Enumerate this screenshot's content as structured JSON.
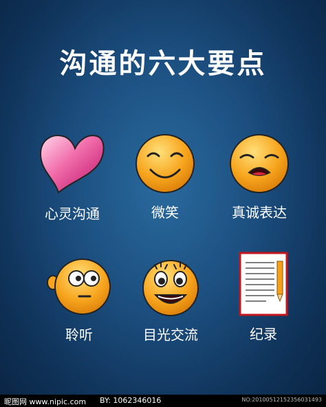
{
  "title": "沟通的六大要点",
  "items": [
    {
      "label": "心灵沟通",
      "icon": "heart-icon"
    },
    {
      "label": "微笑",
      "icon": "smiling-face-icon"
    },
    {
      "label": "真诚表达",
      "icon": "open-mouth-face-icon"
    },
    {
      "label": "聆听",
      "icon": "listening-face-icon"
    },
    {
      "label": "目光交流",
      "icon": "big-eyes-face-icon"
    },
    {
      "label": "纪录",
      "icon": "notepad-pencil-icon"
    }
  ],
  "footer": {
    "site": "昵图网 www.nipic.com",
    "by": "BY: 1062346016",
    "no": "NO:20100512152356031493"
  },
  "colors": {
    "face": "#f7a51e",
    "heart": "#e8418a",
    "background": "#1c4f80"
  }
}
